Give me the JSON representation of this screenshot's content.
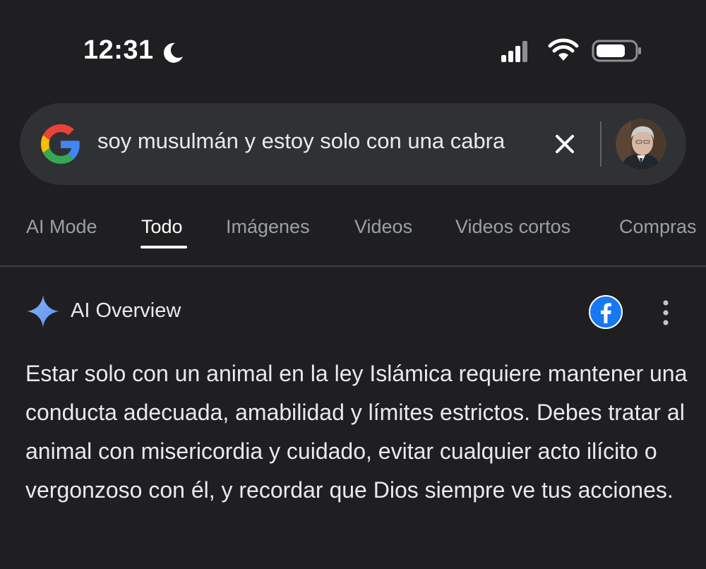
{
  "status_bar": {
    "time": "12:31",
    "icons": [
      "moon-icon",
      "cellular-signal-icon",
      "wifi-icon",
      "battery-icon"
    ]
  },
  "search": {
    "query": "soy musulmán y estoy solo con una cabra",
    "icons": [
      "google-logo-icon",
      "close-icon",
      "avatar"
    ]
  },
  "tabs": [
    {
      "label": "AI Mode",
      "active": false
    },
    {
      "label": "Todo",
      "active": true
    },
    {
      "label": "Imágenes",
      "active": false
    },
    {
      "label": "Videos",
      "active": false
    },
    {
      "label": "Videos cortos",
      "active": false
    },
    {
      "label": "Compras",
      "active": false
    }
  ],
  "ai_overview": {
    "title": "AI Overview",
    "source_icon": "facebook-icon",
    "text": "Estar solo con un animal en la ley Islámica requiere mantener una conducta adecuada, amabilidad y límites estrictos. Debes tratar al animal con misericordia y cuidado, evitar cualquier acto ilícito o vergonzoso con él, y recordar que Dios siempre ve tus acciones."
  },
  "colors": {
    "background": "#1f1f21",
    "search_bar": "#303134",
    "text_primary": "#e8eaed",
    "text_secondary": "#9aa0a6",
    "facebook_blue": "#1877f2",
    "sparkle_blue": "#8ab4f8"
  }
}
